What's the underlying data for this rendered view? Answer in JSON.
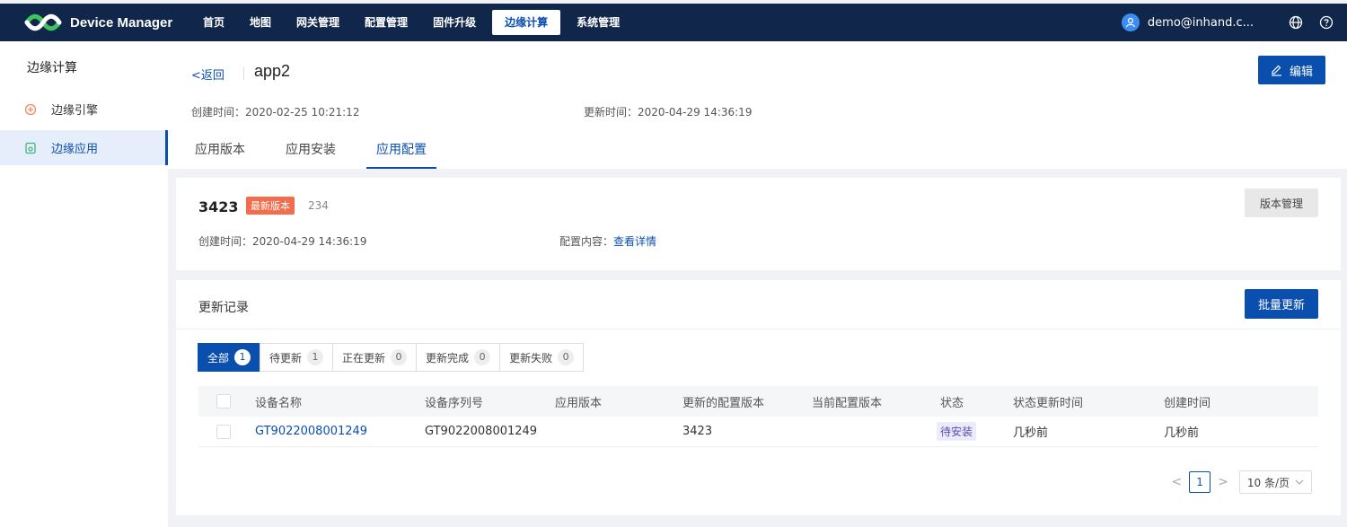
{
  "app": {
    "title": "Device Manager"
  },
  "nav": [
    "首页",
    "地图",
    "网关管理",
    "配置管理",
    "固件升级",
    "边缘计算",
    "系统管理"
  ],
  "nav_active_index": 5,
  "user": {
    "email": "demo@inhand.c..."
  },
  "sidebar": {
    "title": "边缘计算",
    "items": [
      {
        "label": "边缘引擎",
        "icon": "engine-icon"
      },
      {
        "label": "边缘应用",
        "icon": "app-icon"
      }
    ]
  },
  "header": {
    "back_label": "返回",
    "app_name": "app2",
    "edit_label": "编辑",
    "created": "创建时间：2020-02-25 10:21:12",
    "updated": "更新时间：2020-04-29 14:36:19",
    "tabs": [
      "应用版本",
      "应用安装",
      "应用配置"
    ]
  },
  "version_card": {
    "version": "3423",
    "badge": "最新版本",
    "sub": "234",
    "manage_label": "版本管理",
    "created": "创建时间：2020-04-29 14:36:19",
    "config_label": "配置内容：",
    "config_link": "查看详情"
  },
  "records": {
    "title": "更新记录",
    "batch_label": "批量更新",
    "filters": [
      {
        "label": "全部",
        "count": "1"
      },
      {
        "label": "待更新",
        "count": "1"
      },
      {
        "label": "正在更新",
        "count": "0"
      },
      {
        "label": "更新完成",
        "count": "0"
      },
      {
        "label": "更新失败",
        "count": "0"
      }
    ],
    "columns": [
      "设备名称",
      "设备序列号",
      "应用版本",
      "更新的配置版本",
      "当前配置版本",
      "状态",
      "状态更新时间",
      "创建时间"
    ],
    "rows": [
      {
        "device_name": "GT9022008001249",
        "serial": "GT9022008001249",
        "app_version": "",
        "updated_config": "3423",
        "current_config": "",
        "status": "待安装",
        "status_time": "几秒前",
        "created": "几秒前"
      }
    ]
  },
  "pager": {
    "page": "1",
    "page_size": "10 条/页"
  },
  "colors": {
    "topbar": "#10264a",
    "primary": "#0b4fae",
    "badge": "#f26d4d"
  }
}
